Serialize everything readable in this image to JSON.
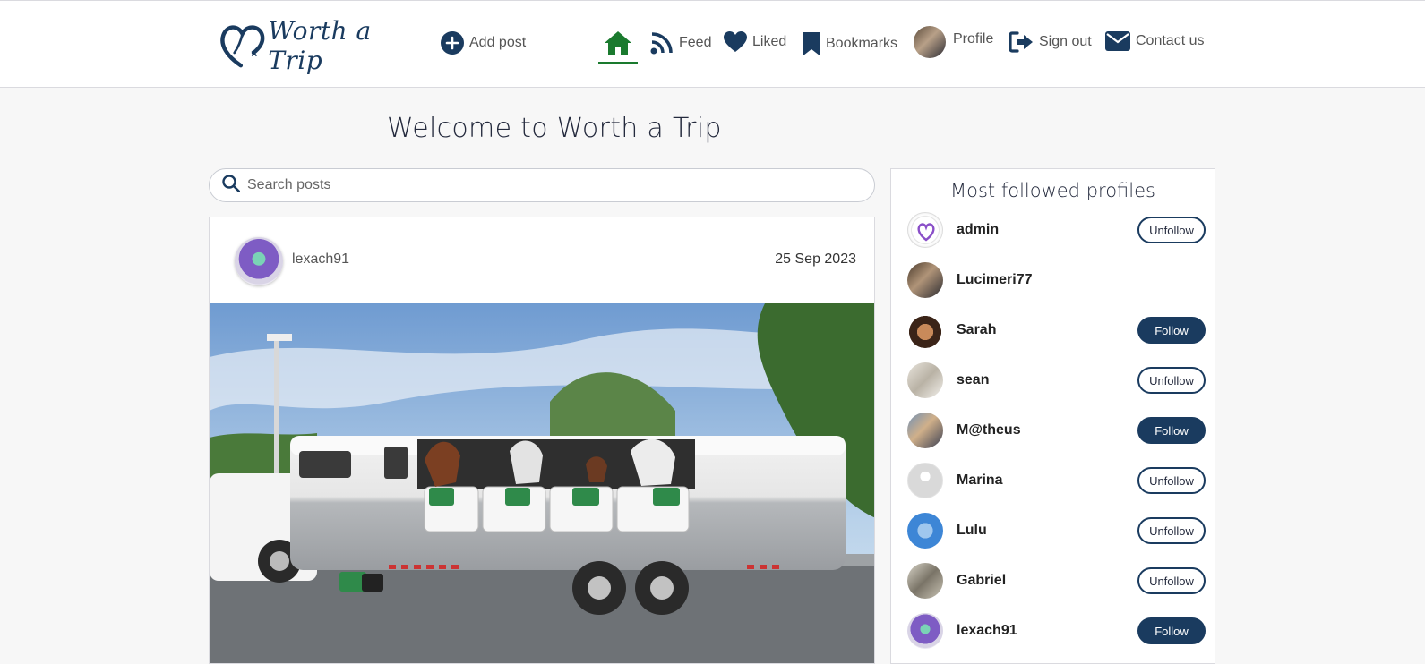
{
  "brand": {
    "name": "Worth a Trip"
  },
  "nav": {
    "add_post": "Add post",
    "feed": "Feed",
    "liked": "Liked",
    "bookmarks": "Bookmarks",
    "profile": "Profile",
    "sign_out": "Sign out",
    "contact_us": "Contact us",
    "active": "home"
  },
  "page": {
    "title": "Welcome to Worth a Trip"
  },
  "search": {
    "placeholder": "Search posts"
  },
  "post": {
    "owner": "lexach91",
    "date": "25 Sep 2023"
  },
  "sidebar": {
    "title": "Most followed profiles",
    "profiles": [
      {
        "name": "admin",
        "button": "Unfollow"
      },
      {
        "name": "Lucimeri77",
        "button": ""
      },
      {
        "name": "Sarah",
        "button": "Follow"
      },
      {
        "name": "sean",
        "button": "Unfollow"
      },
      {
        "name": "M@theus",
        "button": "Follow"
      },
      {
        "name": "Marina",
        "button": "Unfollow"
      },
      {
        "name": "Lulu",
        "button": "Unfollow"
      },
      {
        "name": "Gabriel",
        "button": "Unfollow"
      },
      {
        "name": "lexach91",
        "button": "Follow"
      }
    ]
  },
  "colors": {
    "primary": "#1a3b5f",
    "active_nav": "#1a7a2e",
    "background": "#f7f7f7"
  }
}
